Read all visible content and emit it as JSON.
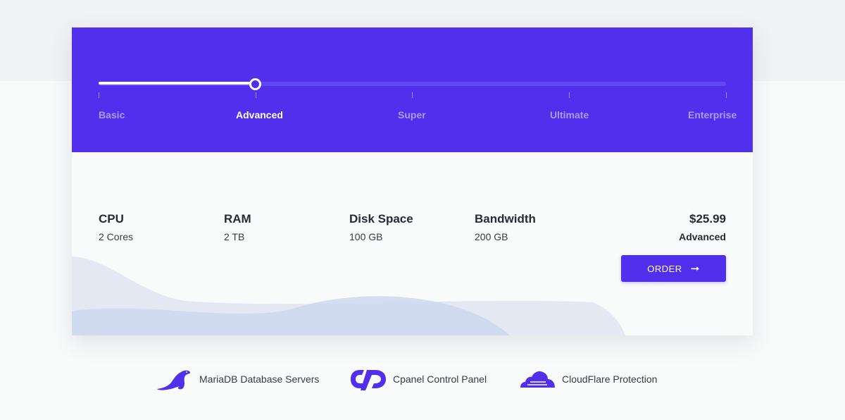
{
  "slider": {
    "tiers": [
      {
        "label": "Basic"
      },
      {
        "label": "Advanced"
      },
      {
        "label": "Super"
      },
      {
        "label": "Ultimate"
      },
      {
        "label": "Enterprise"
      }
    ],
    "selected_index": 1
  },
  "specs": {
    "cpu": {
      "label": "CPU",
      "value": "2 Cores"
    },
    "ram": {
      "label": "RAM",
      "value": "2 TB"
    },
    "disk": {
      "label": "Disk Space",
      "value": "100 GB"
    },
    "bandwidth": {
      "label": "Bandwidth",
      "value": "200 GB"
    }
  },
  "plan": {
    "price": "$25.99",
    "name": "Advanced",
    "order_label": "ORDER",
    "order_icon": "arrow-right-icon"
  },
  "features": [
    {
      "label": "MariaDB Database Servers",
      "icon": "mariadb-seal-icon"
    },
    {
      "label": "Cpanel Control Panel",
      "icon": "cpanel-icon"
    },
    {
      "label": "CloudFlare Protection",
      "icon": "cloudflare-cloud-icon"
    }
  ],
  "colors": {
    "accent": "#512fec",
    "background": "#f9fafa",
    "wave_light": "#e3e8f3",
    "wave_mid": "#cdd8ef"
  }
}
